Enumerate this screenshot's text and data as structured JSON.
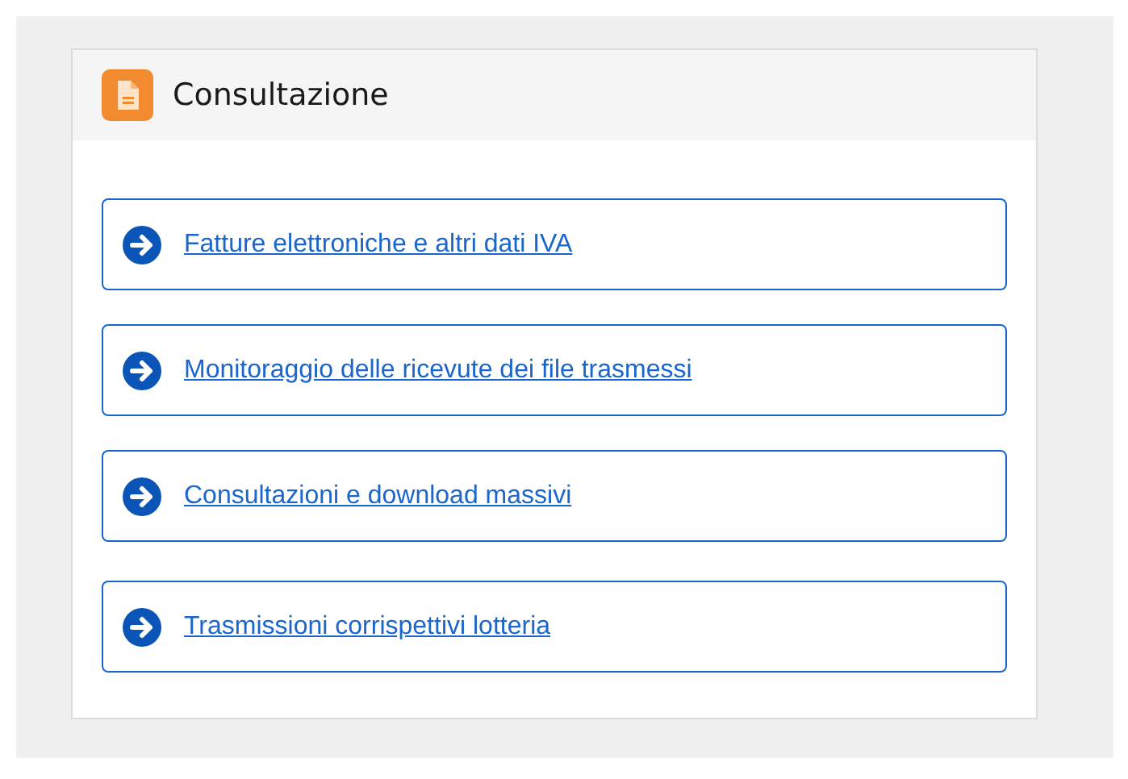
{
  "panel": {
    "title": "Consultazione"
  },
  "links": [
    {
      "label": "Fatture elettroniche e altri dati IVA"
    },
    {
      "label": "Monitoraggio delle ricevute dei file trasmessi"
    },
    {
      "label": "Consultazioni e download massivi"
    },
    {
      "label": "Trasmissioni corrispettivi lotteria"
    }
  ]
}
